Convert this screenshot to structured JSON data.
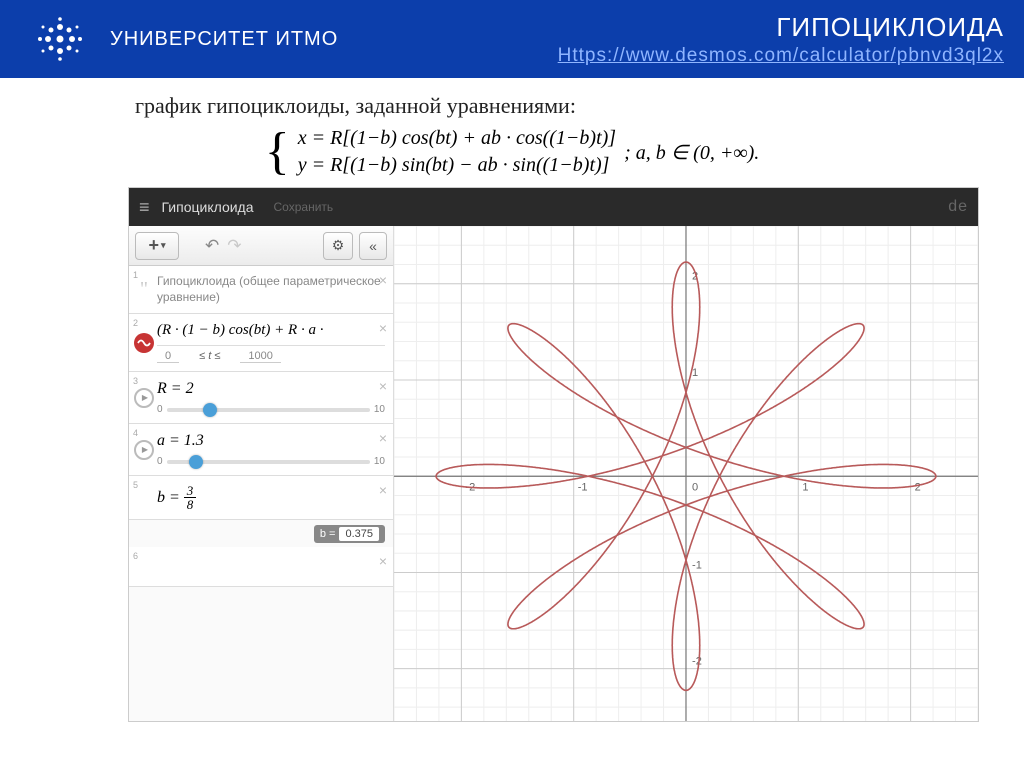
{
  "header": {
    "university": "УНИВЕРСИТЕТ ИТМО",
    "title": "ГИПОЦИКЛОИДА",
    "link": "Https://www.desmos.com/calculator/pbnvd3ql2x"
  },
  "intro": "график  гипоциклоиды, заданной уравнениями:",
  "formula": {
    "line1": "x = R[(1−b) cos(bt) + ab · cos((1−b)t)]",
    "line2": "y = R[(1−b) sin(bt) − ab · sin((1−b)t)]",
    "tail": "; a, b ∈ (0, +∞)."
  },
  "topbar": {
    "title": "Гипоциклоида",
    "save": "Сохранить",
    "brand": "de"
  },
  "sidebar": {
    "folder": "Гипоциклоида (общее параметрическое уравнение)",
    "param_eq": "(R · (1 − b) cos(bt) + R · a ·",
    "t_min": "0",
    "t_ineq": "≤ t ≤",
    "t_max": "1000",
    "R_label": "R = 2",
    "R_min": "0",
    "R_max": "10",
    "R_pos": 18,
    "a_label": "a = 1.3",
    "a_min": "0",
    "a_max": "10",
    "a_pos": 11,
    "b_label": "b =",
    "b_num": "3",
    "b_den": "8",
    "badge_label": "b =",
    "badge_val": "0.375"
  },
  "chart_data": {
    "type": "parametric",
    "R": 2,
    "a": 1.3,
    "b": 0.375,
    "x_eq": "R*((1-b)*cos(b*t) + a*b*cos((1-b)*t))",
    "y_eq": "R*((1-b)*sin(b*t) - a*b*sin((1-b)*t))",
    "t_range": [
      0,
      1000
    ],
    "xlim": [
      -2.6,
      2.6
    ],
    "ylim": [
      -2.6,
      2.6
    ],
    "x_ticks": [
      -2,
      -1,
      0,
      1,
      2
    ],
    "y_ticks": [
      -2,
      -1,
      0,
      1,
      2
    ],
    "petals": 8,
    "color": "#b85a5a"
  }
}
